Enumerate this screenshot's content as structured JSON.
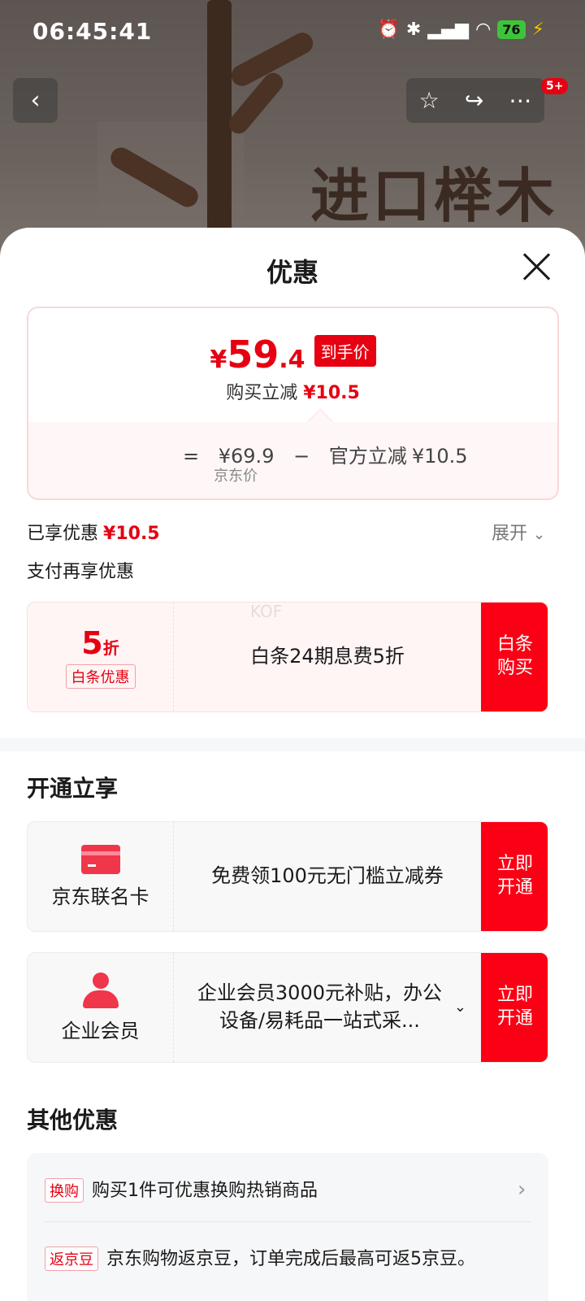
{
  "status_bar": {
    "time": "06:45:41",
    "battery": "76"
  },
  "background": {
    "text": "进口榉木"
  },
  "nav": {
    "badge": "5+"
  },
  "sheet": {
    "title": "优惠"
  },
  "price": {
    "currency": "¥",
    "integer": "59",
    "decimal": ".4",
    "tag": "到手价",
    "save_label": "购买立减",
    "save_value": "¥10.5",
    "formula_eq": "=",
    "jd_price": "¥69.9",
    "formula_minus": "−",
    "official_label": "官方立减",
    "official_value": "¥10.5",
    "jd_price_label": "京东价"
  },
  "enjoyed": {
    "label": "已享优惠",
    "value": "¥10.5",
    "expand": "展开"
  },
  "pay_section": {
    "title": "支付再享优惠"
  },
  "baitiao": {
    "discount": "5",
    "discount_unit": "折",
    "label": "白条优惠",
    "desc": "白条24期息费5折",
    "button": "白条购买",
    "watermark": "KOF"
  },
  "open_section": {
    "title": "开通立享"
  },
  "jd_card": {
    "name": "京东联名卡",
    "desc": "免费领100元无门槛立减券",
    "button": "立即开通"
  },
  "enterprise": {
    "name": "企业会员",
    "desc": "企业会员3000元补贴，办公设备/易耗品一站式采...",
    "button": "立即开通"
  },
  "other_section": {
    "title": "其他优惠",
    "items": [
      {
        "tag": "换购",
        "text": "购买1件可优惠换购热销商品"
      },
      {
        "tag": "返京豆",
        "text": "京东购物返京豆，订单完成后最高可返5京豆。"
      }
    ]
  },
  "colors": {
    "accent": "#e60012",
    "button": "#fb0015"
  }
}
